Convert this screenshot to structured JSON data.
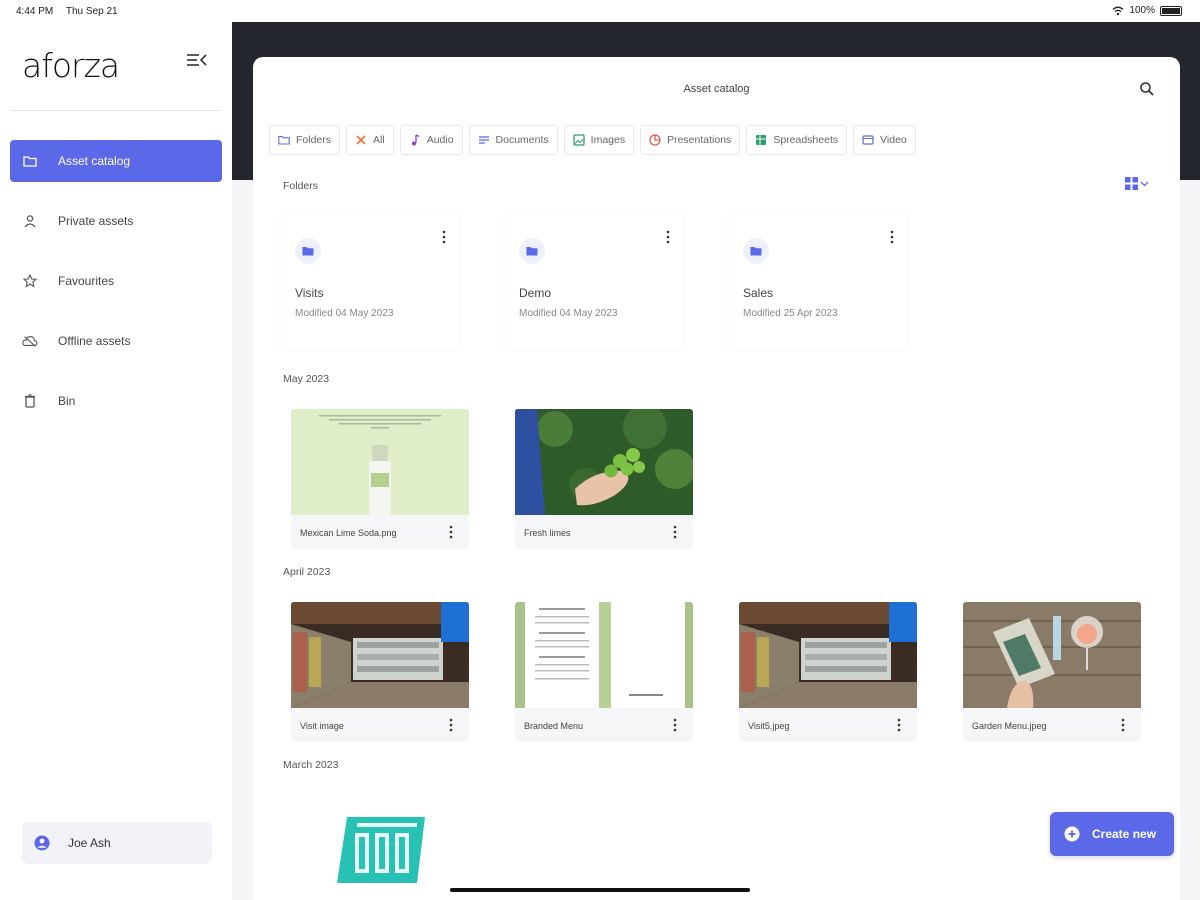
{
  "status": {
    "time": "4:44 PM",
    "date": "Thu Sep 21",
    "battery": "100%"
  },
  "app": {
    "logo": "aforza"
  },
  "sidebar": {
    "items": [
      {
        "label": "Asset catalog",
        "icon": "folder-icon",
        "active": true
      },
      {
        "label": "Private assets",
        "icon": "person-icon",
        "active": false
      },
      {
        "label": "Favourites",
        "icon": "star-icon",
        "active": false
      },
      {
        "label": "Offline assets",
        "icon": "cloud-offline-icon",
        "active": false
      },
      {
        "label": "Bin",
        "icon": "bin-icon",
        "active": false
      }
    ],
    "user": "Joe Ash"
  },
  "header": {
    "title": "Asset catalog"
  },
  "filters": [
    {
      "label": "Folders",
      "icon": "folder-icon",
      "color": "#5b69e8"
    },
    {
      "label": "All",
      "icon": "all-icon",
      "color": "#e8743b"
    },
    {
      "label": "Audio",
      "icon": "music-note-icon",
      "color": "#9b3bc9"
    },
    {
      "label": "Documents",
      "icon": "document-icon",
      "color": "#5b69e8"
    },
    {
      "label": "Images",
      "icon": "image-icon",
      "color": "#2e9e6a"
    },
    {
      "label": "Presentations",
      "icon": "presentation-icon",
      "color": "#e05a4a"
    },
    {
      "label": "Spreadsheets",
      "icon": "spreadsheet-icon",
      "color": "#2e9e6a"
    },
    {
      "label": "Video",
      "icon": "video-icon",
      "color": "#5b69e8"
    }
  ],
  "sections": {
    "folders": "Folders",
    "may": "May 2023",
    "april": "April 2023",
    "march": "March 2023"
  },
  "folders": [
    {
      "name": "Visits",
      "modified": "Modified 04 May 2023"
    },
    {
      "name": "Demo",
      "modified": "Modified 04 May 2023"
    },
    {
      "name": "Sales",
      "modified": "Modified 25 Apr 2023"
    }
  ],
  "assets_may": [
    {
      "name": "Mexican Lime Soda.png"
    },
    {
      "name": "Fresh limes"
    }
  ],
  "assets_april": [
    {
      "name": "Visit image"
    },
    {
      "name": "Branded Menu"
    },
    {
      "name": "Visit5.jpeg"
    },
    {
      "name": "Garden Menu.jpeg"
    }
  ],
  "create_button": {
    "label": "Create new"
  },
  "colors": {
    "accent": "#5b69e8",
    "dark_header": "#23262c"
  }
}
